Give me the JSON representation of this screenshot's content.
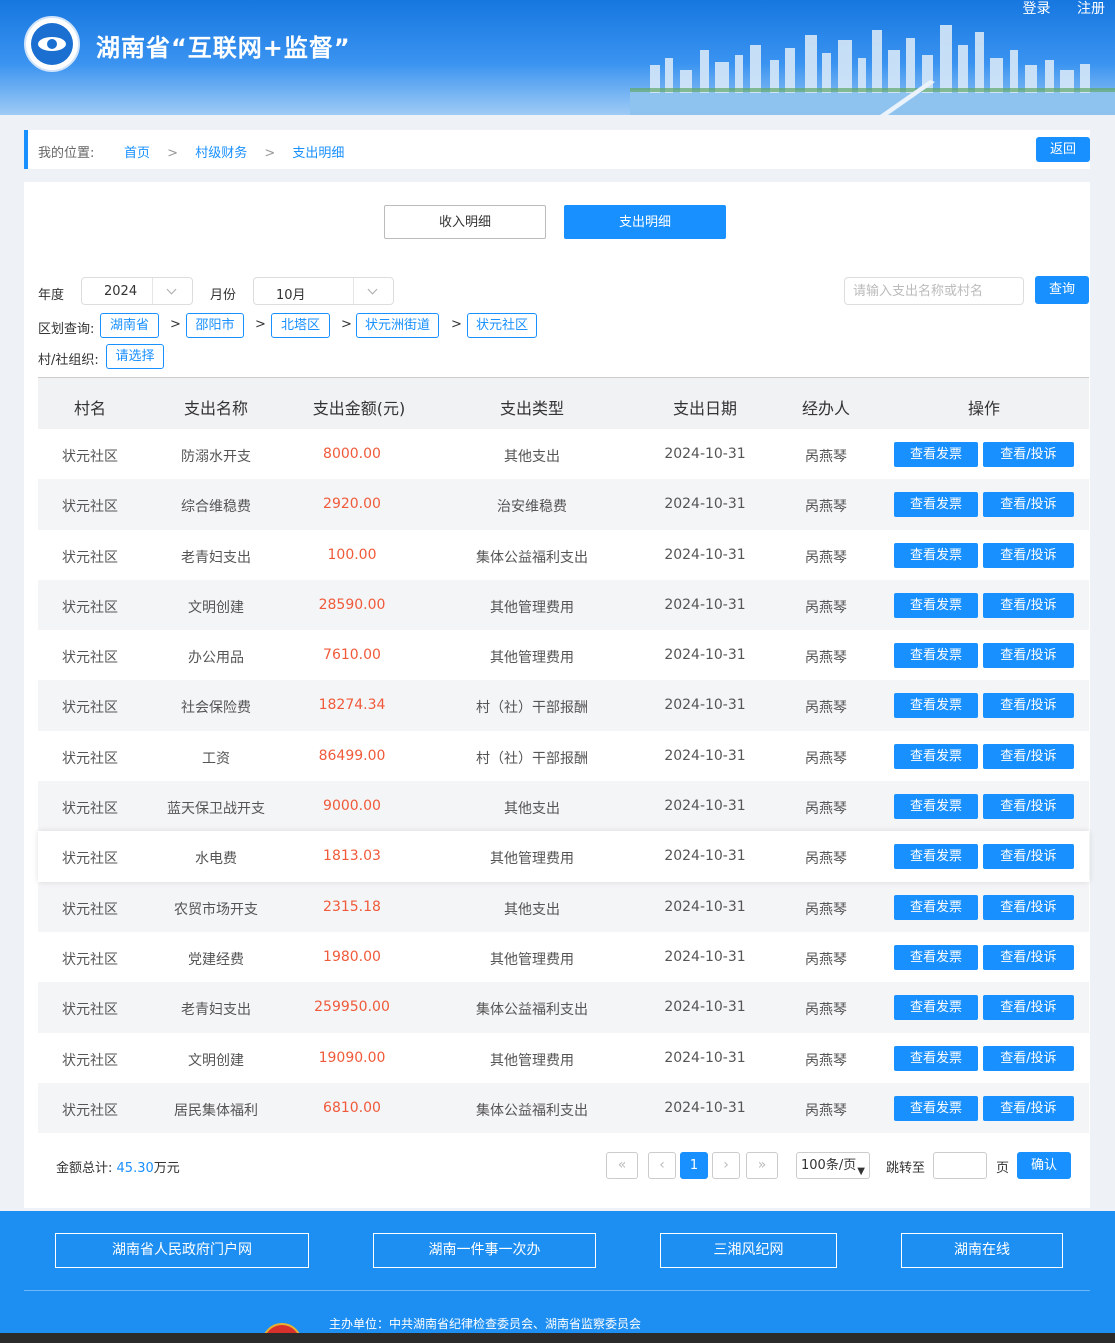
{
  "header": {
    "site_title": "湖南省“互联网+监督”",
    "login": "登录",
    "register": "注册"
  },
  "breadcrumb": {
    "label": "我的位置:",
    "items": [
      "首页",
      "村级财务",
      "支出明细"
    ],
    "sep": ">",
    "back": "返回"
  },
  "tabs": {
    "income": "收入明细",
    "expense": "支出明细"
  },
  "filters": {
    "year_label": "年度",
    "year_value": "2024",
    "month_label": "月份",
    "month_value": "10月",
    "search_placeholder": "请输入支出名称或村名",
    "query": "查询",
    "region_label": "区划查询:",
    "regions": [
      "湖南省",
      "邵阳市",
      "北塔区",
      "状元洲街道",
      "状元社区"
    ],
    "org_label": "村/社组织:",
    "org_choose": "请选择"
  },
  "table": {
    "headers": [
      "村名",
      "支出名称",
      "支出金额(元)",
      "支出类型",
      "支出日期",
      "经办人",
      "操作"
    ],
    "btn_invoice": "查看发票",
    "btn_complain": "查看/投诉",
    "rows": [
      {
        "village": "状元社区",
        "name": "防溺水开支",
        "amount": "8000.00",
        "type": "其他支出",
        "date": "2024-10-31",
        "handler": "呙燕琴"
      },
      {
        "village": "状元社区",
        "name": "综合维稳费",
        "amount": "2920.00",
        "type": "治安维稳费",
        "date": "2024-10-31",
        "handler": "呙燕琴"
      },
      {
        "village": "状元社区",
        "name": "老青妇支出",
        "amount": "100.00",
        "type": "集体公益福利支出",
        "date": "2024-10-31",
        "handler": "呙燕琴"
      },
      {
        "village": "状元社区",
        "name": "文明创建",
        "amount": "28590.00",
        "type": "其他管理费用",
        "date": "2024-10-31",
        "handler": "呙燕琴"
      },
      {
        "village": "状元社区",
        "name": "办公用品",
        "amount": "7610.00",
        "type": "其他管理费用",
        "date": "2024-10-31",
        "handler": "呙燕琴"
      },
      {
        "village": "状元社区",
        "name": "社会保险费",
        "amount": "18274.34",
        "type": "村（社）干部报酬",
        "date": "2024-10-31",
        "handler": "呙燕琴"
      },
      {
        "village": "状元社区",
        "name": "工资",
        "amount": "86499.00",
        "type": "村（社）干部报酬",
        "date": "2024-10-31",
        "handler": "呙燕琴"
      },
      {
        "village": "状元社区",
        "name": "蓝天保卫战开支",
        "amount": "9000.00",
        "type": "其他支出",
        "date": "2024-10-31",
        "handler": "呙燕琴"
      },
      {
        "village": "状元社区",
        "name": "水电费",
        "amount": "1813.03",
        "type": "其他管理费用",
        "date": "2024-10-31",
        "handler": "呙燕琴"
      },
      {
        "village": "状元社区",
        "name": "农贸市场开支",
        "amount": "2315.18",
        "type": "其他支出",
        "date": "2024-10-31",
        "handler": "呙燕琴"
      },
      {
        "village": "状元社区",
        "name": "党建经费",
        "amount": "1980.00",
        "type": "其他管理费用",
        "date": "2024-10-31",
        "handler": "呙燕琴"
      },
      {
        "village": "状元社区",
        "name": "老青妇支出",
        "amount": "259950.00",
        "type": "集体公益福利支出",
        "date": "2024-10-31",
        "handler": "呙燕琴"
      },
      {
        "village": "状元社区",
        "name": "文明创建",
        "amount": "19090.00",
        "type": "其他管理费用",
        "date": "2024-10-31",
        "handler": "呙燕琴"
      },
      {
        "village": "状元社区",
        "name": "居民集体福利",
        "amount": "6810.00",
        "type": "集体公益福利支出",
        "date": "2024-10-31",
        "handler": "呙燕琴"
      }
    ]
  },
  "summary": {
    "total_label": "金额总计:",
    "total_value": "45.30",
    "total_unit": "万元"
  },
  "pagination": {
    "first": "«",
    "prev": "‹",
    "current": "1",
    "next": "›",
    "last": "»",
    "page_size": "100条/页",
    "jump_label": "跳转至",
    "page_word": "页",
    "confirm": "确认"
  },
  "footer": {
    "links": [
      "湖南省人民政府门户网",
      "湖南一件事一次办",
      "三湘风纪网",
      "湖南在线"
    ],
    "host": "主办单位：中共湖南省纪律检查委员会、湖南省监察委员会"
  }
}
